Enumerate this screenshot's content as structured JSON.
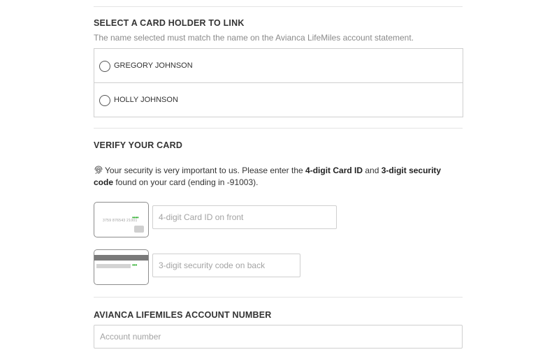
{
  "holder_section": {
    "title": "SELECT A CARD HOLDER TO LINK",
    "subtitle": "The name selected must match the name on the Avianca LifeMiles account statement.",
    "holders": [
      {
        "name": "GREGORY JOHNSON",
        "selected": false
      },
      {
        "name": "HOLLY JOHNSON",
        "selected": false
      }
    ]
  },
  "verify_section": {
    "title": "VERIFY YOUR CARD",
    "security_icon": "fingerprint-icon",
    "message_part1": "Your security is very important to us. Please enter the ",
    "bold1": "4-digit Card ID",
    "message_part2": " and ",
    "bold2": "3-digit security code",
    "message_part3": " found on your card (ending in -91003).",
    "card_front": {
      "number_text": "3759 876543 21001",
      "dots": "••••"
    },
    "card_back": {
      "dots": "•••"
    },
    "card_id_placeholder": "4-digit Card ID on front",
    "security_code_placeholder": "3-digit security code on back",
    "card_id_value": "",
    "security_code_value": ""
  },
  "account_section": {
    "title": "AVIANCA LIFEMILES ACCOUNT NUMBER",
    "account_placeholder": "Account number",
    "account_value": ""
  },
  "colors": {
    "accent_green": "#2eae2e",
    "border": "#cfcfcf",
    "divider": "#e4e4e4"
  }
}
